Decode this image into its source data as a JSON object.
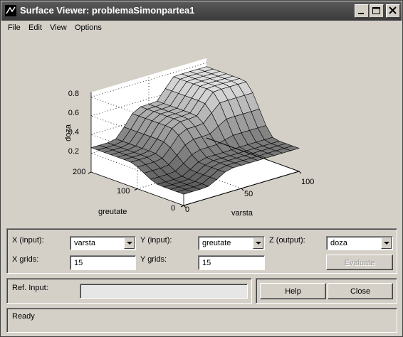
{
  "window": {
    "title": "Surface Viewer: problemaSimonpartea1",
    "controls": [
      "minimize-icon",
      "maximize-icon",
      "close-icon"
    ]
  },
  "menu": {
    "items": [
      "File",
      "Edit",
      "View",
      "Options"
    ]
  },
  "plot": {
    "zlabel": "doza",
    "ylabel": "greutate",
    "xlabel": "varsta",
    "z_ticks": [
      "0.2",
      "0.4",
      "0.6",
      "0.8"
    ],
    "y_ticks": [
      "0",
      "100",
      "200"
    ],
    "x_ticks": [
      "0",
      "50",
      "100"
    ]
  },
  "controls": {
    "x_input_label": "X (input):",
    "x_input_value": "varsta",
    "y_input_label": "Y (input):",
    "y_input_value": "greutate",
    "z_output_label": "Z (output):",
    "z_output_value": "doza",
    "x_grids_label": "X grids:",
    "x_grids_value": "15",
    "y_grids_label": "Y grids:",
    "y_grids_value": "15",
    "evaluate_label": "Evaluate"
  },
  "ref": {
    "label": "Ref. Input:",
    "value": ""
  },
  "buttons": {
    "help": "Help",
    "close": "Close"
  },
  "status": {
    "text": "Ready"
  },
  "colors": {
    "titlebar": "#4a4a4a",
    "background": "#d4d0c8"
  }
}
